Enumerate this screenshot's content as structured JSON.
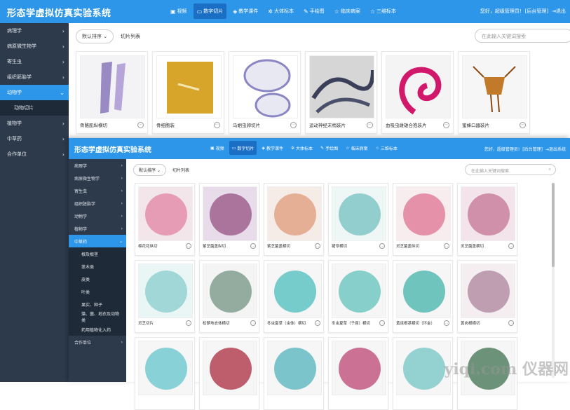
{
  "app": {
    "title": "形态学虚拟仿真实验系统"
  },
  "nav": [
    {
      "icon": "monitor-icon",
      "label": "视频"
    },
    {
      "icon": "slide-icon",
      "label": "数字切片",
      "active": true
    },
    {
      "icon": "course-icon",
      "label": "教学课件"
    },
    {
      "icon": "specimen-icon",
      "label": "大体标本"
    },
    {
      "icon": "drawing-icon",
      "label": "手绘图"
    },
    {
      "icon": "case-icon",
      "label": "临床病案"
    },
    {
      "icon": "3d-icon",
      "label": "三维标本"
    }
  ],
  "user": {
    "greeting": "您好，超级管理员!",
    "admin": "[后台管理]",
    "logout": "退出"
  },
  "sidebar": [
    {
      "label": "病理学"
    },
    {
      "label": "病原微生物学"
    },
    {
      "label": "寄生虫"
    },
    {
      "label": "组织胚胎学"
    },
    {
      "label": "动物学",
      "active": true
    },
    {
      "label": "动物切片",
      "sub": true
    },
    {
      "label": "植物学"
    },
    {
      "label": "中草药"
    },
    {
      "label": "合作单位"
    }
  ],
  "toolbar": {
    "sort": "默认排序",
    "list": "切片列表",
    "search_placeholder": "在此输入关键词搜索"
  },
  "cards": [
    {
      "label": "骨骼肌纵横切"
    },
    {
      "label": "骨细胞装"
    },
    {
      "label": "马蛔虫卵切片"
    },
    {
      "label": "运动神经末梢装片"
    },
    {
      "label": "血吸虫雌雄合抱装片"
    },
    {
      "label": "蜜蜂口器装片"
    }
  ],
  "overlay": {
    "title": "形态学虚拟仿真实验系统",
    "nav": [
      {
        "label": "视频"
      },
      {
        "label": "数字切片",
        "active": true
      },
      {
        "label": "教学课件"
      },
      {
        "label": "大体标本"
      },
      {
        "label": "手绘图"
      },
      {
        "label": "临床病案"
      },
      {
        "label": "三维标本"
      }
    ],
    "user": {
      "greeting": "您好，超级管理员!",
      "admin": "[后台管理]",
      "logout": "退出系统"
    },
    "sidebar": [
      {
        "label": "病理学"
      },
      {
        "label": "病原微生物学"
      },
      {
        "label": "寄生虫"
      },
      {
        "label": "组织胚胎学"
      },
      {
        "label": "动物学"
      },
      {
        "label": "植物学"
      },
      {
        "label": "中草药",
        "active": true
      },
      {
        "label": "根及根茎",
        "sub": true
      },
      {
        "label": "茎木类",
        "sub": true
      },
      {
        "label": "皮类",
        "sub": true
      },
      {
        "label": "叶类",
        "sub": true
      },
      {
        "label": "果实、种子",
        "sub": true
      },
      {
        "label": "藻、菌、地衣及动物类",
        "sub": true
      },
      {
        "label": "药用植物化入药",
        "sub": true
      },
      {
        "label": "合作单位"
      }
    ],
    "toolbar": {
      "sort": "默认排序",
      "list": "切片列表",
      "search_placeholder": "在此输入关键词搜索"
    },
    "cards": [
      {
        "label": "棉花花纵切"
      },
      {
        "label": "紫芝菌盖纵切"
      },
      {
        "label": "紫芝菌盖横切"
      },
      {
        "label": "猪苓横切"
      },
      {
        "label": "灵芝菌盖纵切"
      },
      {
        "label": "灵芝菌盖横切"
      },
      {
        "label": "灵芝切片"
      },
      {
        "label": "松萝地衣体横切"
      },
      {
        "label": "冬虫夏草（虫体）横切"
      },
      {
        "label": "冬虫夏草（子座）横切"
      },
      {
        "label": "黄连根茎横切（环金）"
      },
      {
        "label": "黄岗根横切"
      },
      {
        "label": ""
      },
      {
        "label": ""
      },
      {
        "label": ""
      },
      {
        "label": ""
      },
      {
        "label": ""
      },
      {
        "label": ""
      }
    ]
  },
  "watermark": "yiqi.com 仪器网",
  "colors": {
    "header": "#2e96e8",
    "sidebar": "#2d3a4b",
    "active": "#2e96e8"
  }
}
